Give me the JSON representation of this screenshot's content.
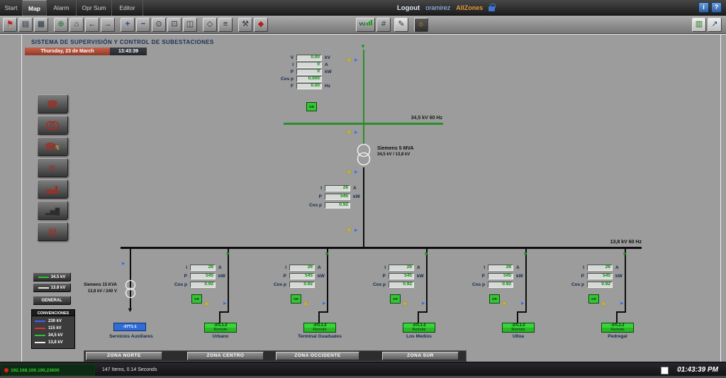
{
  "window": {
    "info": "i",
    "help": "?"
  },
  "menubar": {
    "tabs": [
      {
        "label": "Start"
      },
      {
        "label": "Map"
      },
      {
        "label": "Alarm"
      },
      {
        "label": "Opr Sum"
      },
      {
        "label": "Editor"
      }
    ],
    "active_tab": "Map",
    "logout": "Logout",
    "user": "oramirez",
    "zone": "AllZones"
  },
  "toolbar": {
    "vu_label": "VU",
    "buttons": [
      {
        "name": "alarm-summary-icon",
        "glyph": "⚑"
      },
      {
        "name": "print-icon",
        "glyph": "▤"
      },
      {
        "name": "grid-view-icon",
        "glyph": "▦"
      },
      {
        "name": "world-map-icon",
        "glyph": "⊕"
      },
      {
        "name": "home-view-icon",
        "glyph": "⌂"
      },
      {
        "name": "back-icon",
        "glyph": "←"
      },
      {
        "name": "forward-icon",
        "glyph": "→"
      },
      {
        "name": "zoom-in-icon",
        "glyph": "+"
      },
      {
        "name": "zoom-out-icon",
        "glyph": "−"
      },
      {
        "name": "zoom-extent-icon",
        "glyph": "⊙"
      },
      {
        "name": "zoom-window-icon",
        "glyph": "⊡"
      },
      {
        "name": "zoom-previous-icon",
        "glyph": "◫"
      },
      {
        "name": "pan-icon",
        "glyph": "◇"
      },
      {
        "name": "layers-icon",
        "glyph": "≡"
      },
      {
        "name": "tools-icon",
        "glyph": "⚒"
      },
      {
        "name": "vehicle-icon",
        "glyph": "◆"
      },
      {
        "name": "mixer-icon",
        "glyph": "#"
      },
      {
        "name": "pen-icon",
        "glyph": "✎"
      },
      {
        "name": "lamp-icon",
        "glyph": "☼"
      },
      {
        "name": "chart-icon",
        "glyph": "▥"
      },
      {
        "name": "export-icon",
        "glyph": "↗"
      }
    ]
  },
  "header": {
    "title": "SISTEMA DE SUPERVISIÓN Y CONTROL DE SUBESTACIONES",
    "date": "Thursday, 23 de March",
    "time": "13:43:39"
  },
  "sidebar": {
    "glyphs": {
      "handset": "☎",
      "bolt": "↯",
      "waves": "≋",
      "bars": "▂▅█",
      "notes": "▤"
    }
  },
  "glyphs": {
    "flow_arrow": "▼",
    "switch_open": "×",
    "switch_breaker": "▸"
  },
  "legend": {
    "btn_345": "34.5 kV",
    "btn_138": "13.8 kV",
    "btn_general": "GENERAL",
    "title": "CONVENCIONES",
    "items": [
      {
        "label": "230 kV",
        "color": "#4a5cff"
      },
      {
        "label": "115 kV",
        "color": "#e03030"
      },
      {
        "label": "34,5 kV",
        "color": "#2fc42f"
      },
      {
        "label": "13,8 kV",
        "color": "#f0f0f0"
      }
    ]
  },
  "diagram": {
    "breaker_tag": "GR",
    "bus_high_label": "34,5 kV 60 Hz",
    "bus_low_label": "13,8 kV 60 Hz",
    "incoming": {
      "rows": [
        {
          "label": "V",
          "value": "0.00",
          "unit": "kV"
        },
        {
          "label": "I",
          "value": "0",
          "unit": "A"
        },
        {
          "label": "P",
          "value": "0",
          "unit": "kW"
        },
        {
          "label": "Cos p",
          "value": "0.000",
          "unit": ""
        },
        {
          "label": "F",
          "value": "0.00",
          "unit": "Hz"
        }
      ]
    },
    "main_transformer": {
      "name": "Siemens 5 MVA",
      "ratio": "34,5 kV / 13,8 kV"
    },
    "main_rows": [
      {
        "label": "I",
        "value": "26",
        "unit": "A"
      },
      {
        "label": "P",
        "value": "545",
        "unit": "kW"
      },
      {
        "label": "Cos p",
        "value": "0.92",
        "unit": ""
      }
    ],
    "aux": {
      "transformer": "Siemens 15 KVA",
      "ratio": "13,8 kV / 240 V",
      "tag": "-07T1-1",
      "label": "Servicios Auxiliares"
    },
    "feeders": [
      {
        "name": "Urbano",
        "tag": "-07L1-2",
        "mode": "Remote",
        "rows": [
          {
            "label": "I",
            "value": "26",
            "unit": "A"
          },
          {
            "label": "P",
            "value": "545",
            "unit": "kW"
          },
          {
            "label": "Cos p",
            "value": "0.92",
            "unit": ""
          }
        ]
      },
      {
        "name": "Terminal Guaduales",
        "tag": "-07L1-2",
        "mode": "Remote",
        "rows": [
          {
            "label": "I",
            "value": "26",
            "unit": "A"
          },
          {
            "label": "P",
            "value": "545",
            "unit": "kW"
          },
          {
            "label": "Cos p",
            "value": "0.92",
            "unit": ""
          }
        ]
      },
      {
        "name": "Los Medios",
        "tag": "-07L1-2",
        "mode": "Remote",
        "rows": [
          {
            "label": "I",
            "value": "26",
            "unit": "A"
          },
          {
            "label": "P",
            "value": "545",
            "unit": "kW"
          },
          {
            "label": "Cos p",
            "value": "0.92",
            "unit": ""
          }
        ]
      },
      {
        "name": "Ulloa",
        "tag": "-07L1-2",
        "mode": "Remote",
        "rows": [
          {
            "label": "I",
            "value": "26",
            "unit": "A"
          },
          {
            "label": "P",
            "value": "545",
            "unit": "kW"
          },
          {
            "label": "Cos p",
            "value": "0.92",
            "unit": ""
          }
        ]
      },
      {
        "name": "Pedregal",
        "tag": "-07L1-2",
        "mode": "Remote",
        "rows": [
          {
            "label": "I",
            "value": "26",
            "unit": "A"
          },
          {
            "label": "P",
            "value": "545",
            "unit": "kW"
          },
          {
            "label": "Cos p",
            "value": "0.92",
            "unit": ""
          }
        ]
      }
    ]
  },
  "zones": [
    {
      "label": "ZONA NORTE"
    },
    {
      "label": "ZONA CENTRO"
    },
    {
      "label": "ZONA OCCIDENTE"
    },
    {
      "label": "ZONA SUR"
    }
  ],
  "statusbar": {
    "connection": "192.168.100.100,23600",
    "items": "147 Items, 0.14 Seconds",
    "clock": "01:43:39 PM"
  }
}
